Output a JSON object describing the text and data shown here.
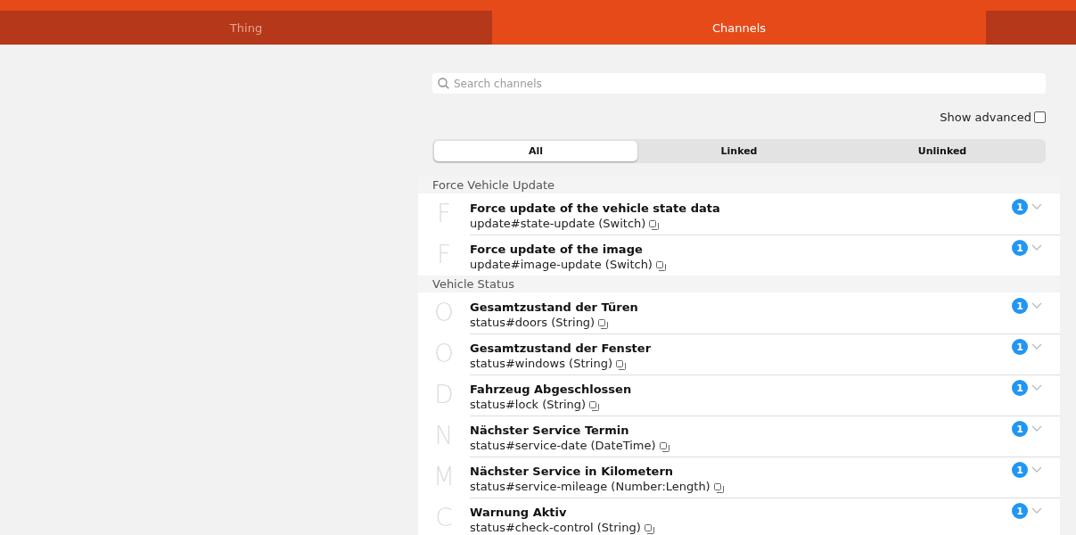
{
  "tabs": [
    {
      "label": "Thing",
      "selected": false
    },
    {
      "label": "Channels",
      "selected": true
    }
  ],
  "search": {
    "placeholder": "Search channels"
  },
  "show_advanced": {
    "label": "Show advanced",
    "checked": false
  },
  "filters": [
    {
      "label": "All",
      "selected": true
    },
    {
      "label": "Linked",
      "selected": false
    },
    {
      "label": "Unlinked",
      "selected": false
    }
  ],
  "groups": [
    {
      "title": "Force Vehicle Update",
      "channels": [
        {
          "letter": "F",
          "label": "Force update of the vehicle state data",
          "id": "update#state-update (Switch)",
          "links": "1"
        },
        {
          "letter": "F",
          "label": "Force update of the image",
          "id": "update#image-update (Switch)",
          "links": "1"
        }
      ]
    },
    {
      "title": "Vehicle Status",
      "channels": [
        {
          "letter": "O",
          "label": "Gesamtzustand der Türen",
          "id": "status#doors (String)",
          "links": "1"
        },
        {
          "letter": "O",
          "label": "Gesamtzustand der Fenster",
          "id": "status#windows (String)",
          "links": "1"
        },
        {
          "letter": "D",
          "label": "Fahrzeug Abgeschlossen",
          "id": "status#lock (String)",
          "links": "1"
        },
        {
          "letter": "N",
          "label": "Nächster Service Termin",
          "id": "status#service-date (DateTime)",
          "links": "1"
        },
        {
          "letter": "M",
          "label": "Nächster Service in Kilometern",
          "id": "status#service-mileage (Number:Length)",
          "links": "1"
        },
        {
          "letter": "C",
          "label": "Warnung Aktiv",
          "id": "status#check-control (String)",
          "links": "1"
        }
      ]
    }
  ]
}
